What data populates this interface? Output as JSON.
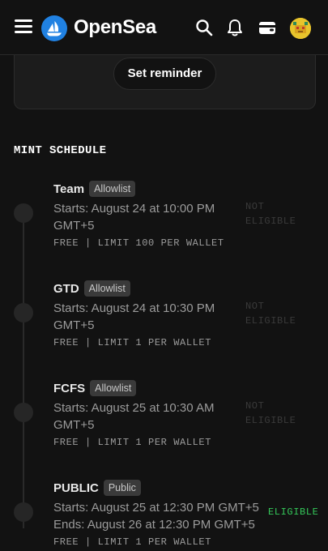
{
  "header": {
    "brand": "OpenSea",
    "menu_icon": "hamburger-menu-icon",
    "logo_icon": "opensea-logo",
    "search_icon": "search-icon",
    "bell_icon": "bell-icon",
    "wallet_icon": "wallet-icon",
    "avatar_icon": "avatar"
  },
  "reminder": {
    "button_label": "Set reminder"
  },
  "schedule": {
    "title": "MINT SCHEDULE",
    "phases": [
      {
        "name": "Team",
        "badge": "Allowlist",
        "line1": "Starts: August 24 at 10:00 PM",
        "line2": "GMT+5",
        "meta": "FREE | LIMIT 100 PER WALLET",
        "status": "NOT ELIGIBLE"
      },
      {
        "name": "GTD",
        "badge": "Allowlist",
        "line1": "Starts: August 24 at 10:30 PM",
        "line2": "GMT+5",
        "meta": "FREE | LIMIT 1 PER WALLET",
        "status": "NOT ELIGIBLE"
      },
      {
        "name": "FCFS",
        "badge": "Allowlist",
        "line1": "Starts: August 25 at 10:30 AM",
        "line2": "GMT+5",
        "meta": "FREE | LIMIT 1 PER WALLET",
        "status": "NOT ELIGIBLE"
      },
      {
        "name": "PUBLIC",
        "badge": "Public",
        "line1": "Starts: August 25 at 12:30 PM GMT+5",
        "line2": "Ends: August 26 at 12:30 PM GMT+5",
        "meta": "FREE | LIMIT 1 PER WALLET",
        "status": "ELIGIBLE"
      }
    ]
  },
  "colors": {
    "background": "#121212",
    "brand_blue": "#2081e2",
    "eligible_green": "#34c759",
    "not_eligible_gray": "#3a3a3a"
  }
}
